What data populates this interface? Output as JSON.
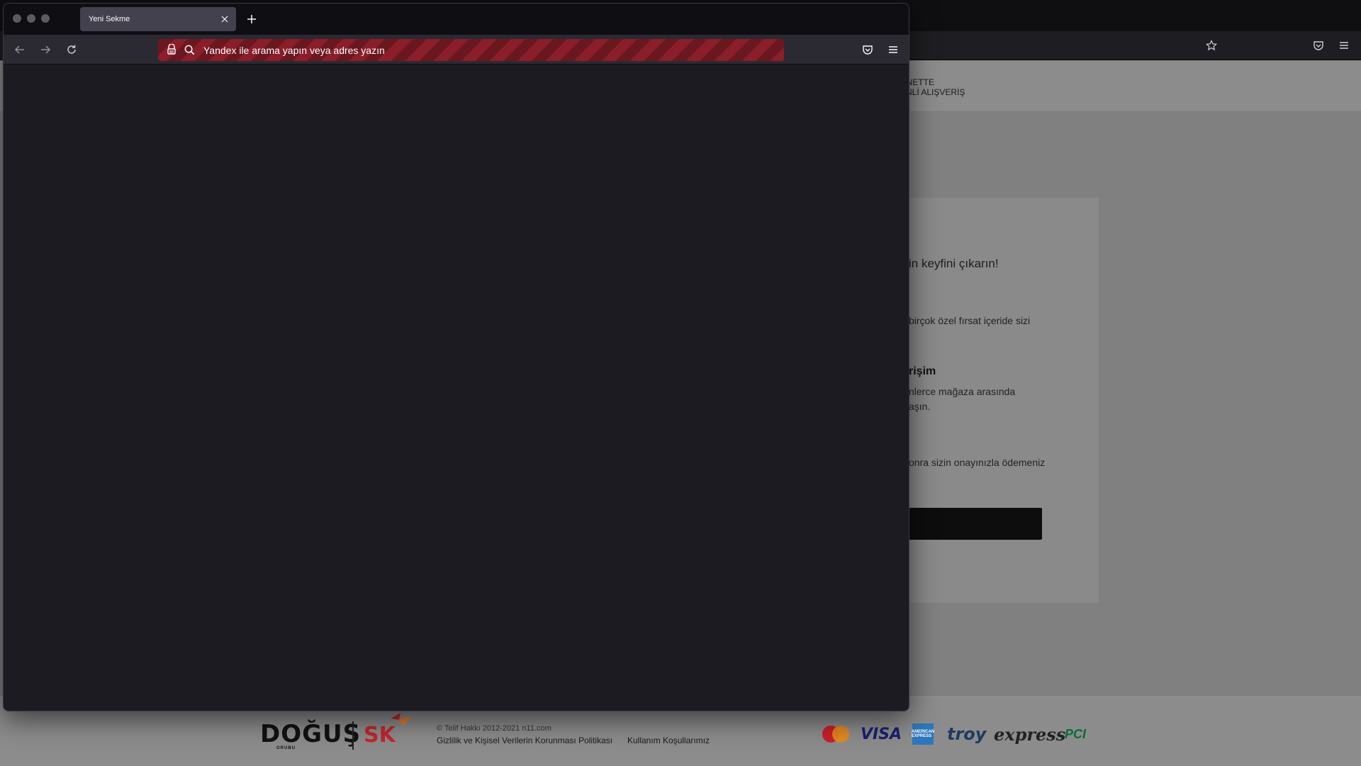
{
  "background_page": {
    "header": {
      "logo_line1": "RNETTE",
      "logo_line2": "ENLİ ALIŞVERİŞ"
    },
    "card": {
      "heading": "in keyfini çıkarın!",
      "desc1": "birçok özel fırsat içeride sizi",
      "subheading": "rişim",
      "desc2_line1": "nlerce mağaza arasında",
      "desc2_line2": "aşın.",
      "desc3": "onra sizin onayınızla ödemeniz"
    },
    "footer": {
      "dogus_logo": "DOĞUŞ",
      "dogus_sub": "GRUBU",
      "sk_logo": "SK",
      "copyright": "© Telif Hakkı 2012-2021 n11.com",
      "privacy_link": "Gizlilik ve Kişisel Verilerin Korunması Politikası",
      "terms_link": "Kullanım Koşullarımız",
      "payment_methods": [
        "MasterCard",
        "VISA",
        "AMERICAN EXPRESS",
        "troy",
        "express",
        "PCI"
      ]
    }
  },
  "browser": {
    "tab": {
      "title": "Yeni Sekme"
    },
    "urlbar": {
      "placeholder": "Yandex ile arama yapın veya adres yazın",
      "value": ""
    },
    "icons": {
      "back": "back-arrow-icon",
      "forward": "forward-arrow-icon",
      "reload": "reload-icon",
      "private": "private-browsing-icon",
      "search": "search-icon",
      "pocket": "pocket-icon",
      "menu": "hamburger-menu-icon",
      "bookmark": "star-icon"
    },
    "colors": {
      "window_bg": "#1c1b22",
      "toolbar_bg": "#2b2a33",
      "private_stripe_a": "#8a1e29",
      "private_stripe_b": "#6b1720"
    }
  }
}
